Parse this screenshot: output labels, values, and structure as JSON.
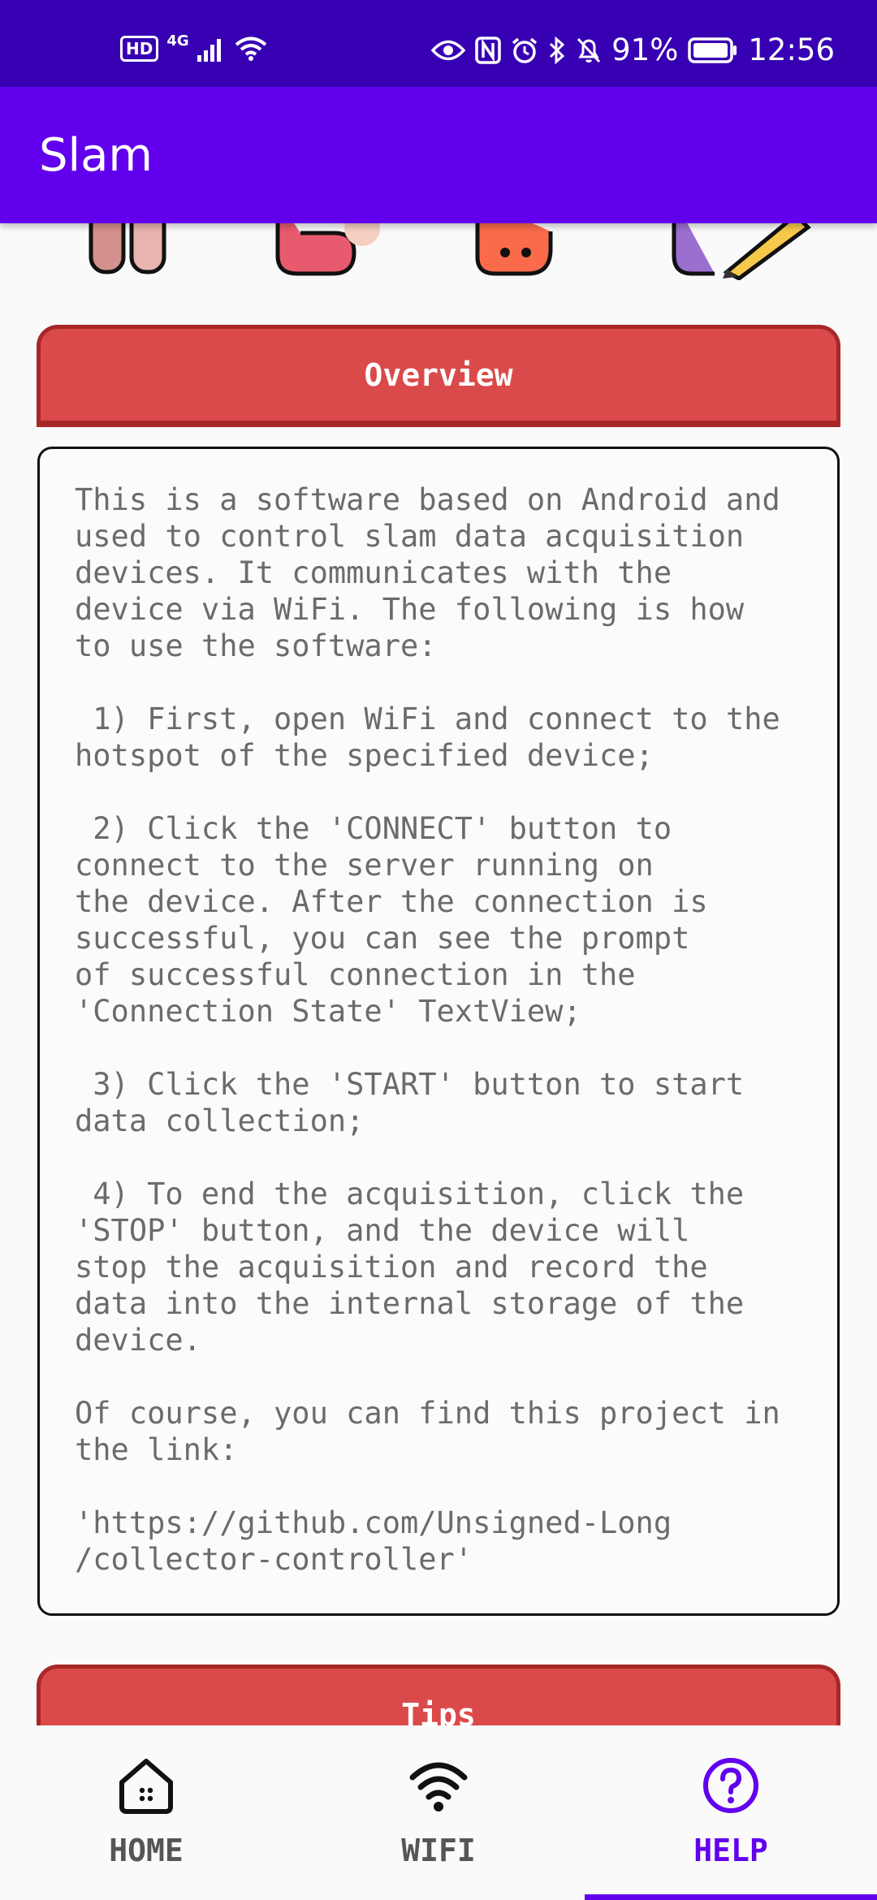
{
  "status_bar": {
    "hd": "HD",
    "network": "4G",
    "battery": "91%",
    "time": "12:56",
    "icons": [
      "hd-icon",
      "signal-icon",
      "wifi-icon",
      "eye-icon",
      "nfc-icon",
      "alarm-icon",
      "bluetooth-icon",
      "mute-icon",
      "battery-icon"
    ]
  },
  "app_bar": {
    "title": "Slam"
  },
  "overview": {
    "header": "Overview",
    "paragraphs": [
      "This is a software based on Android and\nused to control slam data acquisition\ndevices. It communicates with the\ndevice via WiFi. The following is how\nto use the software:",
      " 1) First, open WiFi and connect to the\nhotspot of the specified device;",
      " 2) Click the 'CONNECT' button to\nconnect to the server running on\nthe device. After the connection is\nsuccessful, you can see the prompt\nof successful connection in the\n'Connection State' TextView;",
      " 3) Click the 'START' button to start\ndata collection;",
      " 4) To end the acquisition, click the\n'STOP' button, and the device will\nstop the acquisition and record the\ndata into the internal storage of the\ndevice.",
      "Of course, you can find this project in\nthe link:",
      "'https://github.com/Unsigned-Long\n/collector-controller'"
    ]
  },
  "tips": {
    "header": "Tips"
  },
  "bottom_nav": {
    "items": [
      {
        "label": "HOME",
        "icon": "home-icon"
      },
      {
        "label": "WIFI",
        "icon": "wifi-icon"
      },
      {
        "label": "HELP",
        "icon": "help-icon"
      }
    ],
    "active": "HELP",
    "accent": "#6200ee"
  },
  "colors": {
    "status_bar": "#3700b3",
    "app_bar": "#6200ee",
    "section_header": "#db4a4a",
    "section_border": "#a82828"
  }
}
